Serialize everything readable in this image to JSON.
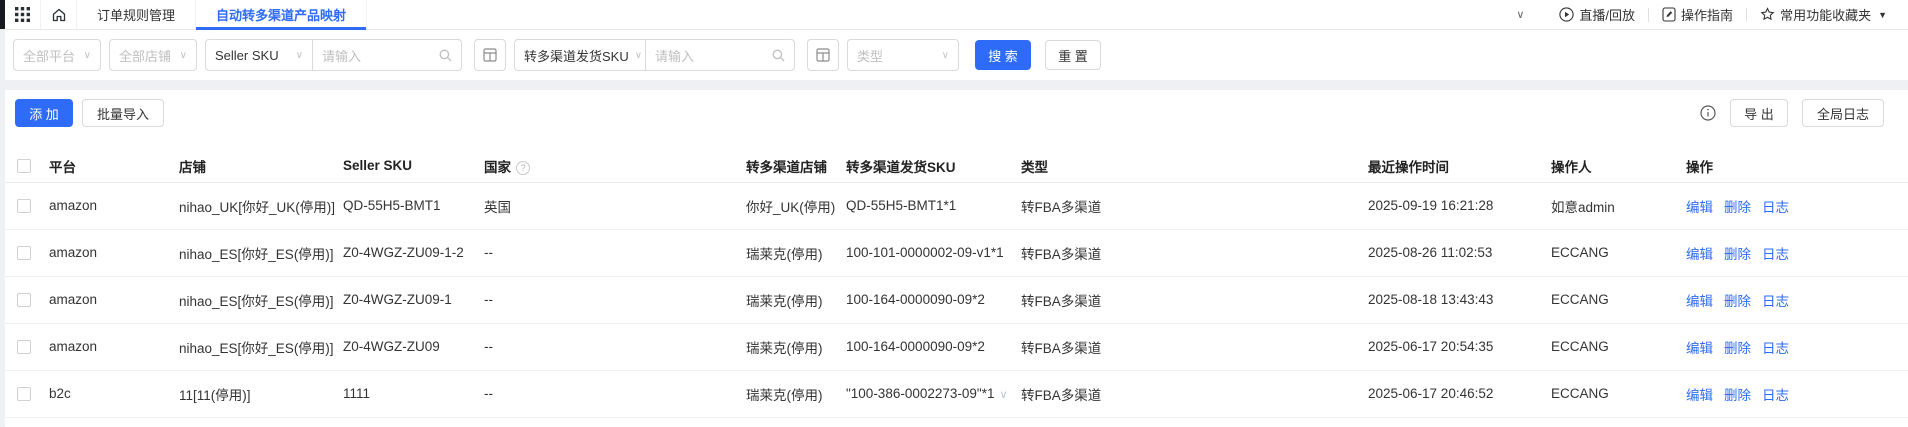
{
  "topbar": {
    "tabs": [
      {
        "label": "订单规则管理",
        "active": false
      },
      {
        "label": "自动转多渠道产品映射",
        "active": true
      }
    ],
    "live_label": "直播/回放",
    "guide_label": "操作指南",
    "favorites_label": "常用功能收藏夹"
  },
  "filters": {
    "platform_placeholder": "全部平台",
    "shop_placeholder": "全部店铺",
    "seller_sku_label": "Seller SKU",
    "seller_sku_input_placeholder": "请输入",
    "channel_sku_label": "转多渠道发货SKU",
    "channel_sku_input_placeholder": "请输入",
    "type_placeholder": "类型",
    "search_label": "搜 索",
    "reset_label": "重 置"
  },
  "toolbar": {
    "add_label": "添 加",
    "batch_import_label": "批量导入",
    "export_label": "导 出",
    "global_log_label": "全局日志"
  },
  "table": {
    "headers": [
      {
        "label": "平台"
      },
      {
        "label": "店铺"
      },
      {
        "label": "Seller SKU"
      },
      {
        "label": "国家",
        "help": true
      },
      {
        "label": "转多渠道店铺"
      },
      {
        "label": "转多渠道发货SKU"
      },
      {
        "label": "类型"
      },
      {
        "label": "最近操作时间"
      },
      {
        "label": "操作人"
      },
      {
        "label": "操作"
      }
    ],
    "action_labels": [
      "编辑",
      "删除",
      "日志"
    ],
    "rows": [
      {
        "platform": "amazon",
        "shop": "nihao_UK[你好_UK(停用)]",
        "seller_sku": "QD-55H5-BMT1",
        "country": "英国",
        "channel_shop": "你好_UK(停用)",
        "channel_sku": "QD-55H5-BMT1*1",
        "type": "转FBA多渠道",
        "time": "2025-09-19 16:21:28",
        "operator": "如意admin",
        "expandable": false
      },
      {
        "platform": "amazon",
        "shop": "nihao_ES[你好_ES(停用)]",
        "seller_sku": "Z0-4WGZ-ZU09-1-2",
        "country": "--",
        "channel_shop": "瑞莱克(停用)",
        "channel_sku": "100-101-0000002-09-v1*1",
        "type": "转FBA多渠道",
        "time": "2025-08-26 11:02:53",
        "operator": "ECCANG",
        "expandable": false
      },
      {
        "platform": "amazon",
        "shop": "nihao_ES[你好_ES(停用)]",
        "seller_sku": "Z0-4WGZ-ZU09-1",
        "country": "--",
        "channel_shop": "瑞莱克(停用)",
        "channel_sku": "100-164-0000090-09*2",
        "type": "转FBA多渠道",
        "time": "2025-08-18 13:43:43",
        "operator": "ECCANG",
        "expandable": false
      },
      {
        "platform": "amazon",
        "shop": "nihao_ES[你好_ES(停用)]",
        "seller_sku": "Z0-4WGZ-ZU09",
        "country": "--",
        "channel_shop": "瑞莱克(停用)",
        "channel_sku": "100-164-0000090-09*2",
        "type": "转FBA多渠道",
        "time": "2025-06-17 20:54:35",
        "operator": "ECCANG",
        "expandable": false
      },
      {
        "platform": "b2c",
        "shop": "11[11(停用)]",
        "seller_sku": "1111",
        "country": "--",
        "channel_shop": "瑞莱克(停用)",
        "channel_sku": "\"100-386-0002273-09\"*1",
        "type": "转FBA多渠道",
        "time": "2025-06-17 20:46:52",
        "operator": "ECCANG",
        "expandable": true
      }
    ]
  },
  "colors": {
    "accent": "#2e6bf6",
    "link": "#2e6bf6"
  }
}
